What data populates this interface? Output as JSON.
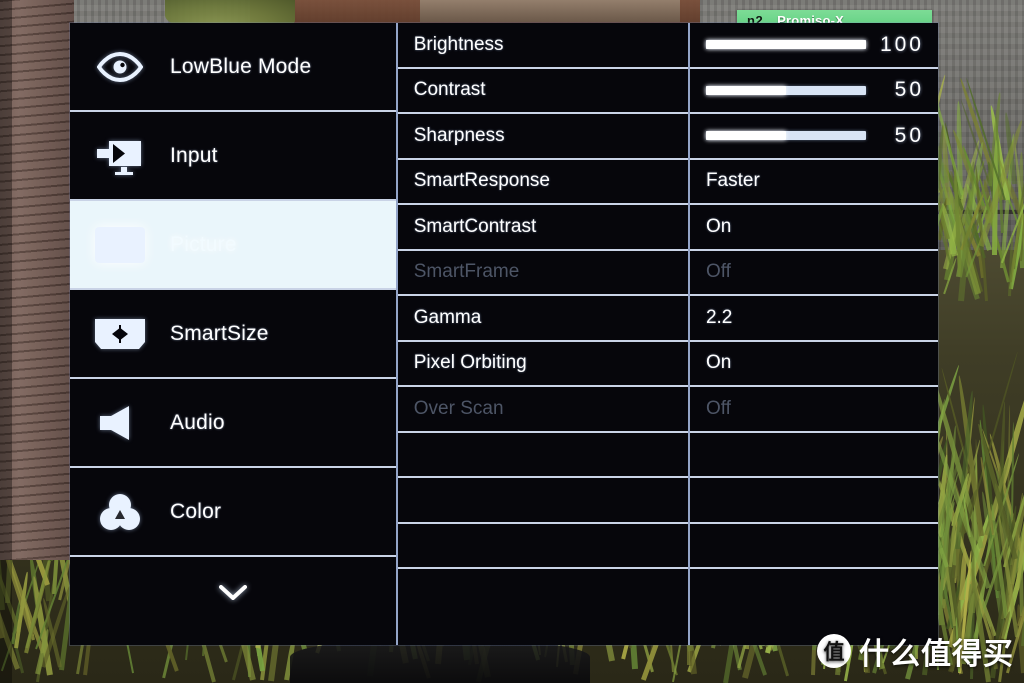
{
  "overlay_banner": {
    "number": "n2",
    "name": "Promiso-X"
  },
  "sidebar": {
    "items": [
      {
        "label": "LowBlue Mode",
        "icon": "eye-icon",
        "active": false
      },
      {
        "label": "Input",
        "icon": "input-monitor-icon",
        "active": false
      },
      {
        "label": "Picture",
        "icon": "picture-icon",
        "active": true
      },
      {
        "label": "SmartSize",
        "icon": "smartsize-icon",
        "active": false
      },
      {
        "label": "Audio",
        "icon": "speaker-icon",
        "active": false
      },
      {
        "label": "Color",
        "icon": "color-circles-icon",
        "active": false
      }
    ],
    "more_icon": "chevron-down-icon"
  },
  "menu": {
    "rows": [
      {
        "label": "Brightness",
        "type": "slider",
        "value": "100",
        "percent": 100,
        "disabled": false
      },
      {
        "label": "Contrast",
        "type": "slider",
        "value": "50",
        "percent": 50,
        "disabled": false
      },
      {
        "label": "Sharpness",
        "type": "slider",
        "value": "50",
        "percent": 50,
        "disabled": false
      },
      {
        "label": "SmartResponse",
        "type": "text",
        "value": "Faster",
        "disabled": false
      },
      {
        "label": "SmartContrast",
        "type": "text",
        "value": "On",
        "disabled": false
      },
      {
        "label": "SmartFrame",
        "type": "text",
        "value": "Off",
        "disabled": true
      },
      {
        "label": "Gamma",
        "type": "text",
        "value": "2.2",
        "disabled": false
      },
      {
        "label": "Pixel Orbiting",
        "type": "text",
        "value": "On",
        "disabled": false
      },
      {
        "label": "Over Scan",
        "type": "text",
        "value": "Off",
        "disabled": true
      },
      {
        "label": "",
        "type": "text",
        "value": "",
        "disabled": false
      },
      {
        "label": "",
        "type": "text",
        "value": "",
        "disabled": false
      },
      {
        "label": "",
        "type": "text",
        "value": "",
        "disabled": false
      }
    ]
  },
  "watermark": {
    "logo_char": "值",
    "text": "什么值得买"
  },
  "colors": {
    "osd_background": "#06060b",
    "divider": "#c9d3e6",
    "highlight_row": "#eaf6fb",
    "text": "#ffffff",
    "text_disabled": "#4d5566",
    "banner_green": "#5fcf80"
  }
}
